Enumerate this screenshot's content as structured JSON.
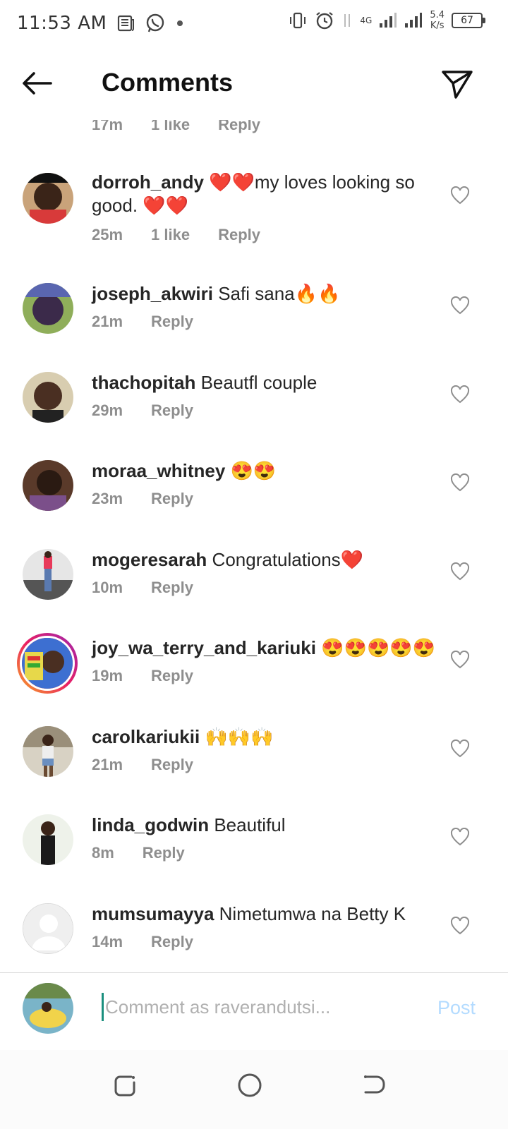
{
  "status_bar": {
    "time": "11:53 AM",
    "network_type": "4G",
    "net_speed_value": "5.4",
    "net_speed_unit": "K/s",
    "battery": "67"
  },
  "header": {
    "title": "Comments"
  },
  "partial_row": {
    "time": "17m",
    "likes": "1 like",
    "reply": "Reply"
  },
  "comments": [
    {
      "username": "dorroh_andy",
      "text": "❤️❤️my loves looking so good. ❤️❤️",
      "time": "25m",
      "likes": "1 like",
      "reply": "Reply"
    },
    {
      "username": "joseph_akwiri",
      "text": "Safi sana🔥🔥",
      "time": "21m",
      "reply": "Reply"
    },
    {
      "username": "thachopitah",
      "text": "Beautfl couple",
      "time": "29m",
      "reply": "Reply"
    },
    {
      "username": "moraa_whitney",
      "text": "😍😍",
      "time": "23m",
      "reply": "Reply"
    },
    {
      "username": "mogeresarah",
      "text": "Congratulations❤️",
      "time": "10m",
      "reply": "Reply"
    },
    {
      "username": "joy_wa_terry_and_kariuki",
      "text": "😍😍😍😍😍",
      "time": "19m",
      "reply": "Reply"
    },
    {
      "username": "carolkariukii",
      "text": "🙌🙌🙌",
      "time": "21m",
      "reply": "Reply"
    },
    {
      "username": "linda_godwin",
      "text": "Beautiful",
      "time": "8m",
      "reply": "Reply"
    },
    {
      "username": "mumsumayya",
      "text": "Nimetumwa na Betty K",
      "time": "14m",
      "reply": "Reply"
    }
  ],
  "composer": {
    "placeholder": "Comment as raverandutsi...",
    "post_label": "Post"
  },
  "icons": {
    "back": "arrow-left-icon",
    "share": "paper-plane-icon",
    "like": "heart-outline-icon"
  },
  "colors": {
    "secondary_text": "#8e8e8e",
    "post_disabled": "#b3dbff",
    "cursor": "#1a8f7e"
  }
}
